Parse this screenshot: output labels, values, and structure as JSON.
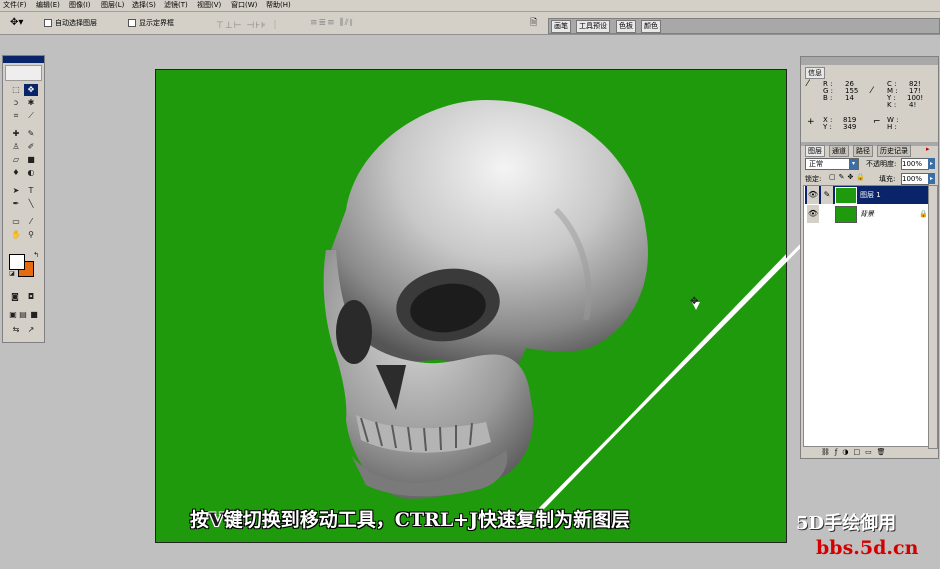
{
  "menu": [
    "文件(F)",
    "编辑(E)",
    "图像(I)",
    "图层(L)",
    "选择(S)",
    "滤镜(T)",
    "视图(V)",
    "窗口(W)",
    "帮助(H)"
  ],
  "options": {
    "auto_select_label": "自动选择图层",
    "show_bounds_label": "显示定界框"
  },
  "dock_tabs": [
    "画笔",
    "工具预设",
    "色板",
    "颜色"
  ],
  "info_panel": {
    "tab": "信息",
    "r": "26",
    "g": "155",
    "b": "14",
    "c": "82!",
    "m": "17!",
    "y_cmyk": "100!",
    "k": "4!",
    "x": "819",
    "y": "349"
  },
  "layers_panel": {
    "tabs": [
      "图层",
      "通道",
      "路径",
      "历史记录"
    ],
    "blend_mode": "正常",
    "opacity_label": "不透明度:",
    "opacity_value": "100%",
    "lock_label": "锁定:",
    "fill_label": "填充:",
    "fill_value": "100%",
    "layers": [
      {
        "name": "图层 1",
        "selected": true
      },
      {
        "name": "背景",
        "selected": false
      }
    ]
  },
  "caption": {
    "part1": "按",
    "key": "V",
    "part2": "键切换到移动工具，CTRL+J快速复制为新图层"
  },
  "watermark": {
    "line1": "5D手绘御用",
    "line2": "bbs.5d.cn"
  },
  "colors": {
    "canvas_bg": "#1f9a0c",
    "fg_swatch": "#ffffff",
    "bg_swatch": "#e86a10"
  }
}
